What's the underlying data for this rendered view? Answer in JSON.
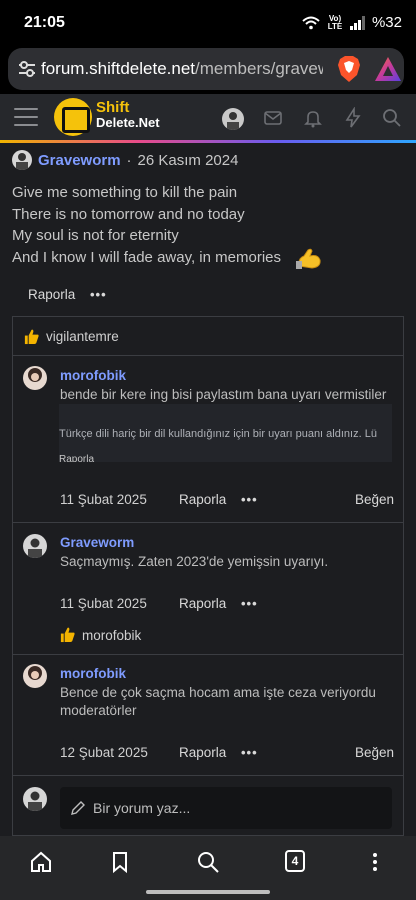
{
  "status": {
    "time": "21:05",
    "signal": "Vo) LTE",
    "battery": "%32"
  },
  "browser": {
    "url_host": "forum.shiftdelete.net",
    "url_path": "/members/gravew",
    "tab_count": "4"
  },
  "site": {
    "logo_line1": "Shift",
    "logo_line2": "Delete.Net"
  },
  "post": {
    "author": "Graveworm",
    "separator": "·",
    "date": "26 Kasım 2024",
    "lines": [
      "Give me something to kill the pain",
      "There is no tomorrow and no today",
      "My soul is not for eternity",
      "And I know I will fade away, in memories"
    ],
    "report_label": "Raporla",
    "more_label": "•••"
  },
  "reactions": {
    "user": "vigilantemre"
  },
  "comments": [
    {
      "author": "morofobik",
      "text": "bende bir kere ing bisi paylastım bana uyarı vermistiler",
      "quote_text": "Türkçe dili hariç bir dil kullandığınız için bir uyarı puanı aldınız. Lü",
      "quote_report": "Raporla",
      "date": "11 Şubat 2025",
      "report": "Raporla",
      "more": "•••",
      "like": "Beğen"
    },
    {
      "author": "Graveworm",
      "text": "Saçmaymış. Zaten 2023'de yemişsin uyarıyı.",
      "date": "11 Şubat 2025",
      "report": "Raporla",
      "more": "•••",
      "reaction_user": "morofobik"
    },
    {
      "author": "morofobik",
      "text_line1": "Bence de çok saçma hocam ama işte ceza veriyordu",
      "text_line2": "moderatörler",
      "date": "12 Şubat 2025",
      "report": "Raporla",
      "more": "•••",
      "like": "Beğen"
    }
  ],
  "reply": {
    "placeholder": "Bir yorum yaz..."
  },
  "colors": {
    "accent": "#7f9cff",
    "brand": "#f5c20b",
    "background": "#1c1d20"
  }
}
